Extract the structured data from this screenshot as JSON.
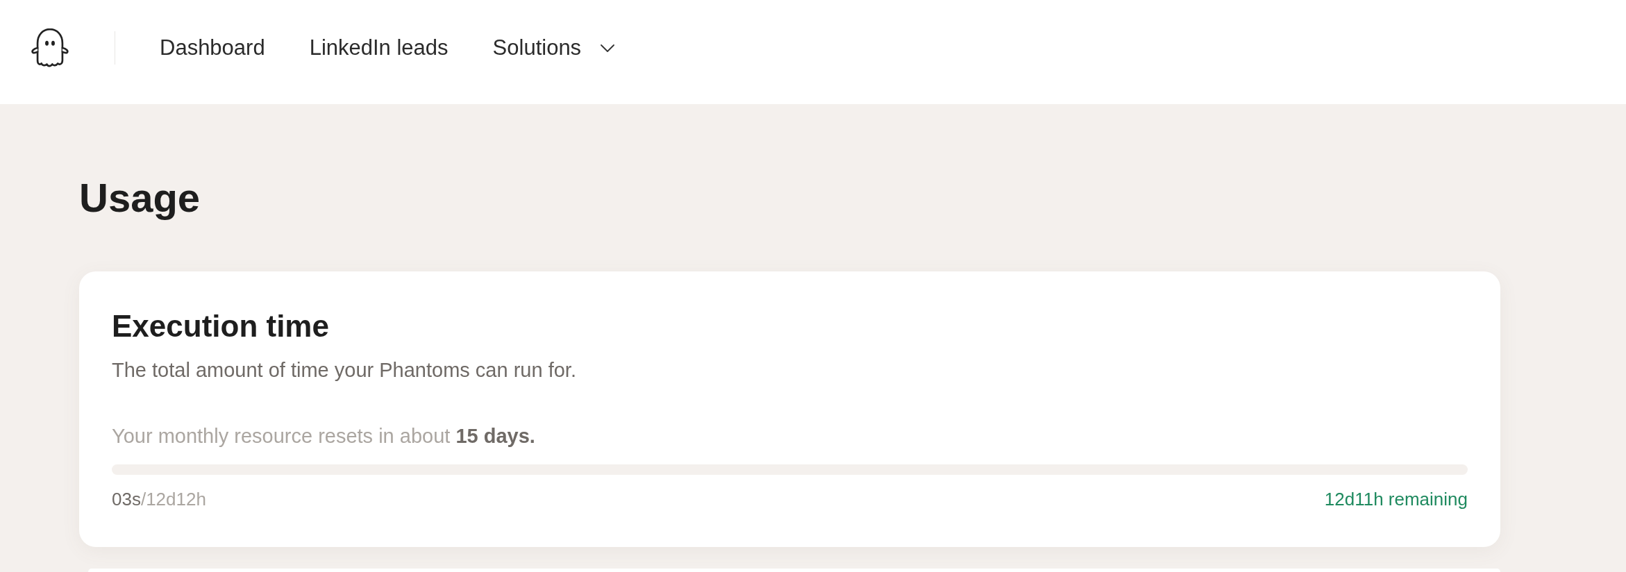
{
  "nav": {
    "items": [
      {
        "label": "Dashboard",
        "kind": "link"
      },
      {
        "label": "LinkedIn leads",
        "kind": "link"
      },
      {
        "label": "Solutions",
        "kind": "dropdown"
      }
    ]
  },
  "page": {
    "title": "Usage"
  },
  "cards": [
    {
      "title": "Execution time",
      "description": "The total amount of time your Phantoms can run for.",
      "reset_note": "Your monthly resource resets in about **15 days.**",
      "level": 0,
      "used": "03s",
      "limit": "/12d12h",
      "remaining": "12d11h remaining"
    }
  ]
}
